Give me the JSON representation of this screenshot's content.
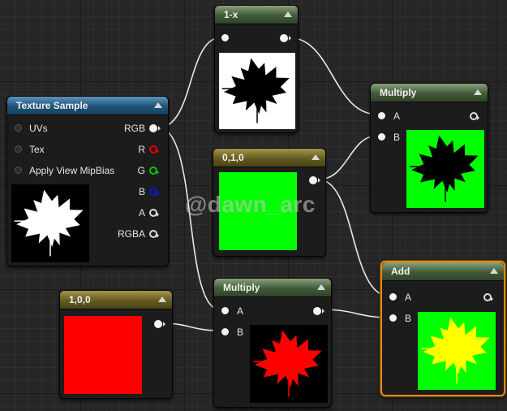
{
  "watermark": "@dawn_arc",
  "nodes": {
    "texture_sample": {
      "title": "Texture Sample",
      "inputs": [
        "UVs",
        "Tex",
        "Apply View MipBias"
      ],
      "outputs": [
        "RGB",
        "R",
        "G",
        "B",
        "A",
        "RGBA"
      ],
      "preview": {
        "background": "#000000",
        "leaf": "#ffffff"
      }
    },
    "one_minus": {
      "title": "1-x",
      "preview": {
        "background": "#ffffff",
        "leaf": "#000000"
      }
    },
    "multiply_top": {
      "title": "Multiply",
      "inputs": [
        "A",
        "B"
      ],
      "preview": {
        "background": "#00ff00",
        "leaf": "#000000"
      }
    },
    "constant_green": {
      "title": "0,1,0",
      "color": "#00ff00"
    },
    "constant_red": {
      "title": "1,0,0",
      "color": "#ff0000"
    },
    "multiply_bottom": {
      "title": "Multiply",
      "inputs": [
        "A",
        "B"
      ],
      "preview": {
        "background": "#000000",
        "leaf": "#ff0000"
      }
    },
    "add": {
      "title": "Add",
      "inputs": [
        "A",
        "B"
      ],
      "preview": {
        "background": "#00ff00",
        "leaf": "#ffff00"
      }
    }
  },
  "colors": {
    "selection": "#e48a10",
    "wire": "#e8e8e8"
  }
}
